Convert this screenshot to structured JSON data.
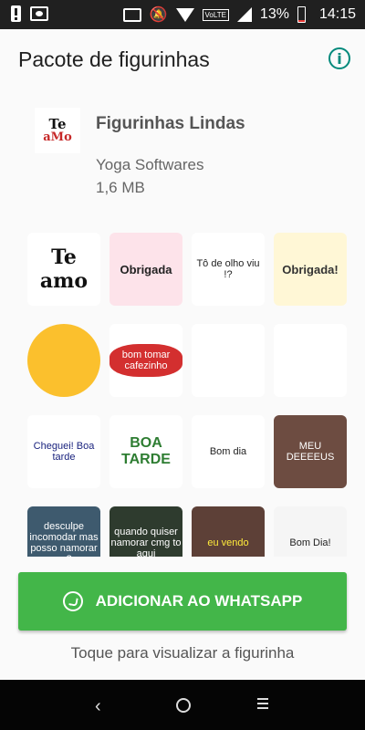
{
  "status_bar": {
    "battery_percent": "13%",
    "time": "14:15",
    "network_label": "VoLTE",
    "icons": [
      "alert-icon",
      "screenshot-icon",
      "cast-icon",
      "mute-icon",
      "wifi-icon",
      "signal-icon",
      "battery-icon"
    ]
  },
  "app_bar": {
    "title": "Pacote de figurinhas",
    "info_icon": "info-icon",
    "info_color": "#00897b"
  },
  "pack": {
    "icon_text_top": "Te",
    "icon_text_bottom": "aMo",
    "name": "Figurinhas Lindas",
    "author": "Yoga Softwares",
    "size": "1,6 MB"
  },
  "stickers": [
    {
      "text": "Te amo",
      "bg": "#ffffff",
      "fg": "#111111"
    },
    {
      "text": "Obrigada",
      "bg": "#fde3ea",
      "fg": "#222222"
    },
    {
      "text": "Tô de olho viu !?",
      "bg": "#ffffff",
      "fg": "#222222"
    },
    {
      "text": "Obrigada!",
      "bg": "#fff7d6",
      "fg": "#333333"
    },
    {
      "text": "",
      "bg": "#fff3c4",
      "fg": "#333333"
    },
    {
      "text": "bom tomar cafezinho",
      "bg": "#ffffff",
      "fg": "#ffffff"
    },
    {
      "text": "",
      "bg": "#ffffff",
      "fg": "#333333"
    },
    {
      "text": "",
      "bg": "#ffffff",
      "fg": "#d81b60"
    },
    {
      "text": "Cheguei! Boa tarde",
      "bg": "#ffffff",
      "fg": "#1a237e"
    },
    {
      "text": "BOA TARDE",
      "bg": "#ffffff",
      "fg": "#2e7d32"
    },
    {
      "text": "Bom dia",
      "bg": "#ffffff",
      "fg": "#222222"
    },
    {
      "text": "MEU DEEEEUS",
      "bg": "#6d4c41",
      "fg": "#ffffff"
    },
    {
      "text": "desculpe incomodar mas posso namorar vc?",
      "bg": "#3e5a6e",
      "fg": "#ffffff"
    },
    {
      "text": "quando quiser namorar cmg to aqui",
      "bg": "#2e3b2e",
      "fg": "#ffffff"
    },
    {
      "text": "eu vendo",
      "bg": "#5d4037",
      "fg": "#ffeb3b"
    },
    {
      "text": "Bom Dia!",
      "bg": "#f5f5f5",
      "fg": "#222222"
    }
  ],
  "add_button": {
    "label": "ADICIONAR AO WHATSAPP",
    "icon": "whatsapp-icon",
    "color": "#43b649"
  },
  "hint": "Toque para visualizar a figurinha",
  "nav_bar": {
    "back_icon": "back-icon",
    "home_icon": "home-icon",
    "menu_icon": "menu-icon"
  }
}
